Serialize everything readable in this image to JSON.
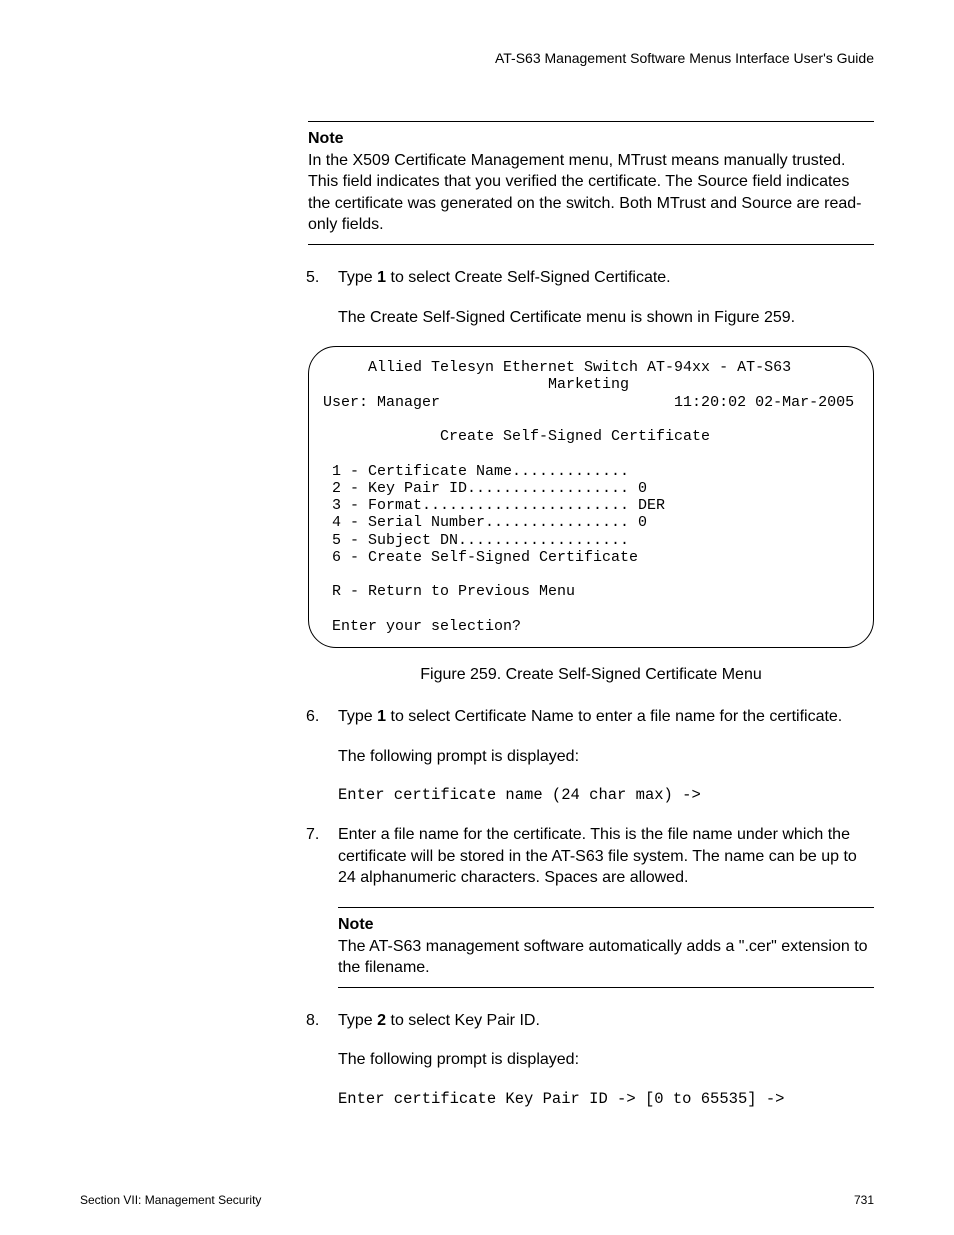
{
  "header": {
    "guide_title": "AT-S63 Management Software Menus Interface User's Guide"
  },
  "note1": {
    "title": "Note",
    "body": "In the X509 Certificate Management menu, MTrust means manually trusted. This field indicates that you verified the certificate. The Source field indicates the certificate was generated on the switch. Both MTrust and Source are read-only fields."
  },
  "step5": {
    "num": "5.",
    "line_a": "Type ",
    "bold": "1",
    "line_b": " to select Create Self-Signed Certificate.",
    "followup": "The Create Self-Signed Certificate menu is shown in Figure 259."
  },
  "terminal": {
    "title_line": "     Allied Telesyn Ethernet Switch AT-94xx - AT-S63",
    "sub_line": "                         Marketing",
    "user_line": "User: Manager                          11:20:02 02-Mar-2005",
    "menu_title": "             Create Self-Signed Certificate",
    "opt1": " 1 - Certificate Name.............",
    "opt2": " 2 - Key Pair ID.................. 0",
    "opt3": " 3 - Format....................... DER",
    "opt4": " 4 - Serial Number................ 0",
    "opt5": " 5 - Subject DN...................",
    "opt6": " 6 - Create Self-Signed Certificate",
    "optR": " R - Return to Previous Menu",
    "prompt": " Enter your selection?"
  },
  "figure_caption": "Figure 259. Create Self-Signed Certificate Menu",
  "step6": {
    "num": "6.",
    "line_a": "Type ",
    "bold": "1",
    "line_b": " to select Certificate Name to enter a file name for the certificate.",
    "followup": "The following prompt is displayed:",
    "mono": "Enter certificate name (24 char max) ->"
  },
  "step7": {
    "num": "7.",
    "body": "Enter a file name for the certificate. This is the file name under which the certificate will be stored in the AT-S63 file system. The name can be up to 24 alphanumeric characters. Spaces are allowed."
  },
  "note2": {
    "title": "Note",
    "body": "The AT-S63 management software automatically adds a \".cer\" extension to the filename."
  },
  "step8": {
    "num": "8.",
    "line_a": "Type ",
    "bold": "2",
    "line_b": " to select Key Pair ID.",
    "followup": "The following prompt is displayed:",
    "mono": "Enter certificate Key Pair ID -> [0 to 65535] ->"
  },
  "footer": {
    "section": "Section VII: Management Security",
    "page": "731"
  }
}
